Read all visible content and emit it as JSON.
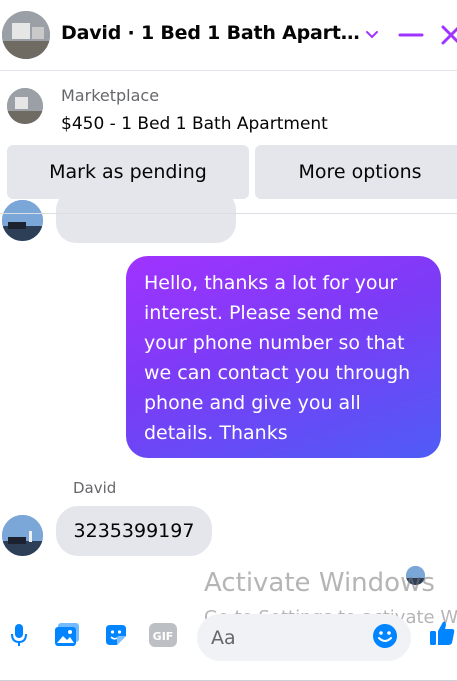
{
  "header": {
    "title": "David · 1 Bed 1 Bath Apart…",
    "icons": [
      "chevron-down-icon",
      "minimize-icon",
      "close-icon"
    ]
  },
  "marketplace": {
    "label": "Marketplace",
    "listing": "$450 - 1 Bed 1 Bath Apartment"
  },
  "actions": {
    "mark_pending": "Mark as pending",
    "more_options": "More options"
  },
  "messages": {
    "outgoing": "Hello, thanks a lot for your interest. Please send me your phone number so that we can contact you through phone and give you all details. Thanks",
    "sender": "David",
    "incoming": "3235399197"
  },
  "watermark": {
    "title": "Activate Windows",
    "subtitle": "Go to Settings to activate W"
  },
  "composer": {
    "placeholder": "Aa",
    "icons": [
      "microphone-icon",
      "image-icon",
      "sticker-icon",
      "gif-icon",
      "emoji-icon",
      "thumbs-up-icon"
    ],
    "gif_label": "GIF"
  },
  "colors": {
    "accent": "#a033ff",
    "bubble_gradient_start": "#a033ff",
    "bubble_gradient_end": "#4f5cf6",
    "composer_icon": "#0084ff"
  }
}
